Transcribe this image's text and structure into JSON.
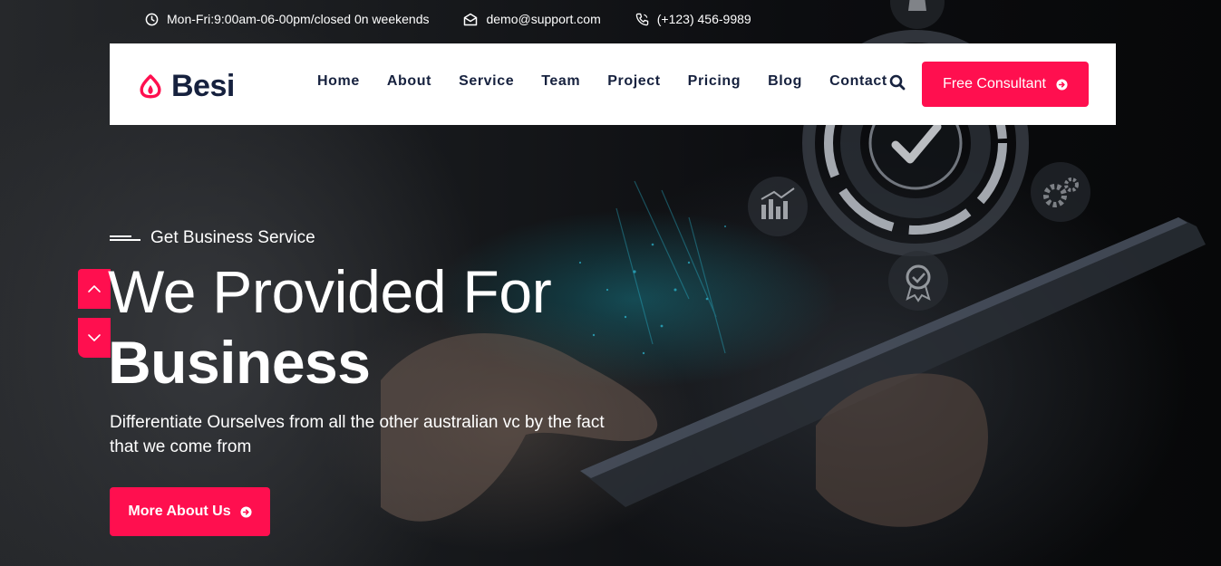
{
  "topbar": {
    "hours": "Mon-Fri:9:00am-06-00pm/closed 0n weekends",
    "email": "demo@support.com",
    "phone": "(+123) 456-9989"
  },
  "header": {
    "logo_text": "Besi",
    "nav": [
      "Home",
      "About",
      "Service",
      "Team",
      "Project",
      "Pricing",
      "Blog",
      "Contact"
    ],
    "cta_label": "Free Consultant"
  },
  "hero": {
    "eyebrow": "Get Business Service",
    "headline_line1": "We Provided For",
    "headline_line2": "Business",
    "description": "Differentiate Ourselves from all the other australian vc by the fact that we come from",
    "button_label": "More About Us"
  },
  "icons": {
    "hours": "clock-icon",
    "email": "envelope-icon",
    "phone": "phone-icon",
    "search": "search-icon",
    "cta_arrow": "arrow-circle-right-icon",
    "slider_prev": "chevron-up-icon",
    "slider_next": "chevron-down-icon"
  },
  "colors": {
    "accent": "#ff0f4f",
    "brand_text": "#16213e",
    "header_bg": "#ffffff"
  }
}
